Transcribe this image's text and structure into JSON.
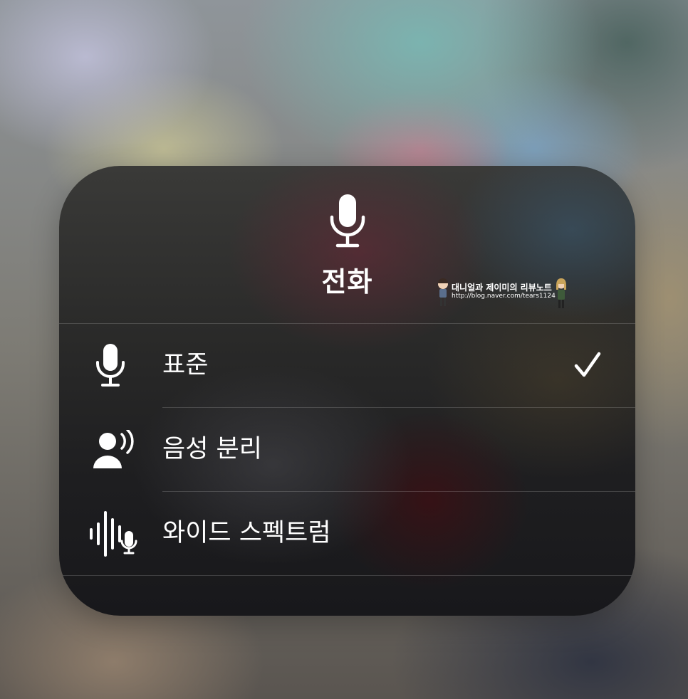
{
  "panel": {
    "title": "전화",
    "title_icon": "microphone-icon"
  },
  "watermark": {
    "line1": "대니얼과 제이미의 리뷰노트",
    "line2": "http://blog.naver.com/tears1124"
  },
  "mic_modes": [
    {
      "label": "표준",
      "icon": "microphone-icon",
      "selected": true
    },
    {
      "label": "음성 분리",
      "icon": "voice-isolation-icon",
      "selected": false
    },
    {
      "label": "와이드 스펙트럼",
      "icon": "wide-spectrum-icon",
      "selected": false
    }
  ],
  "colors": {
    "text": "#ffffff",
    "divider": "rgba(255,255,255,0.16)"
  }
}
